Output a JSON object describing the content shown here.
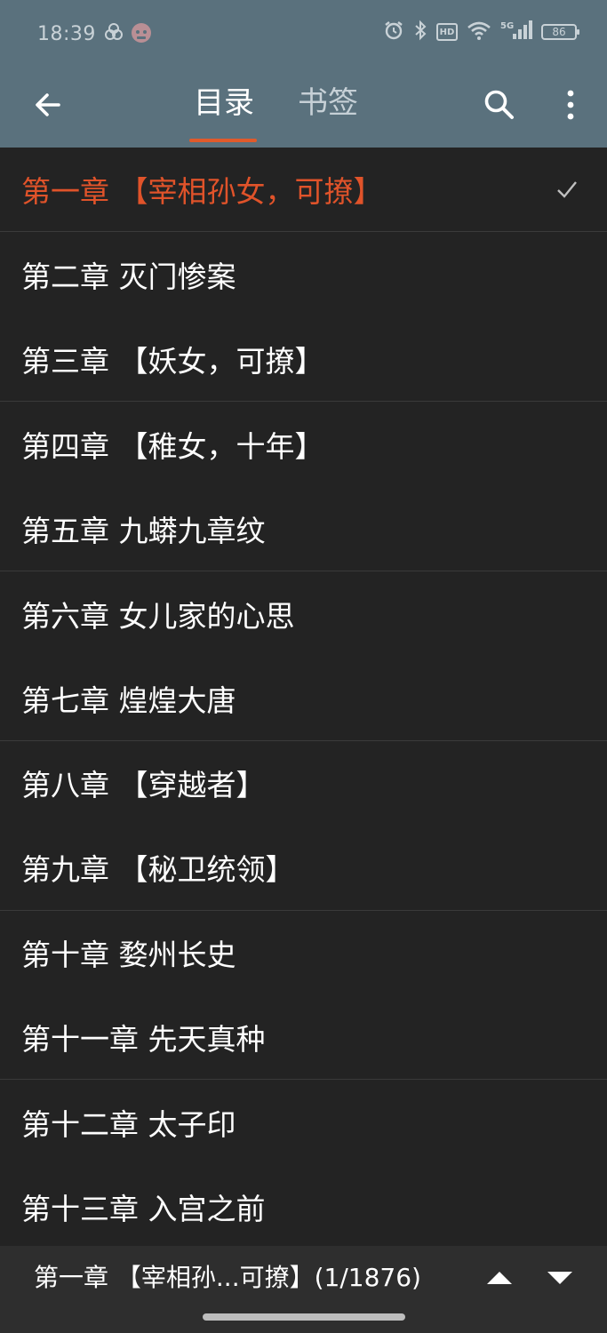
{
  "status_bar": {
    "time": "18:39",
    "battery_level": "86",
    "network": "5G",
    "hd_label": "HD",
    "icons": [
      "app-icon-1",
      "app-icon-2",
      "alarm-icon",
      "bluetooth-icon",
      "hd-icon",
      "wifi-icon",
      "signal-icon",
      "battery-icon"
    ]
  },
  "toolbar": {
    "tabs": [
      {
        "label": "目录",
        "active": true
      },
      {
        "label": "书签",
        "active": false
      }
    ],
    "icons": [
      "back-arrow-icon",
      "search-icon",
      "more-vert-icon"
    ]
  },
  "chapters": [
    {
      "title": "第一章 【宰相孙女，可撩】",
      "current": true
    },
    {
      "title": "第二章 灭门惨案",
      "current": false
    },
    {
      "title": "第三章 【妖女，可撩】",
      "current": false
    },
    {
      "title": "第四章 【稚女，十年】",
      "current": false
    },
    {
      "title": "第五章 九蟒九章纹",
      "current": false
    },
    {
      "title": "第六章 女儿家的心思",
      "current": false
    },
    {
      "title": "第七章 煌煌大唐",
      "current": false
    },
    {
      "title": "第八章 【穿越者】",
      "current": false
    },
    {
      "title": "第九章 【秘卫统领】",
      "current": false
    },
    {
      "title": "第十章 婺州长史",
      "current": false
    },
    {
      "title": "第十一章 先天真种",
      "current": false
    },
    {
      "title": "第十二章 太子印",
      "current": false
    },
    {
      "title": "第十三章 入宫之前",
      "current": false
    }
  ],
  "bottom_bar": {
    "current_chapter": "第一章 【宰相孙...可撩】(1/1876)"
  },
  "colors": {
    "header": "#5a717d",
    "background": "#232323",
    "accent": "#e0532a",
    "bottom_bar": "#2e2e2e"
  }
}
